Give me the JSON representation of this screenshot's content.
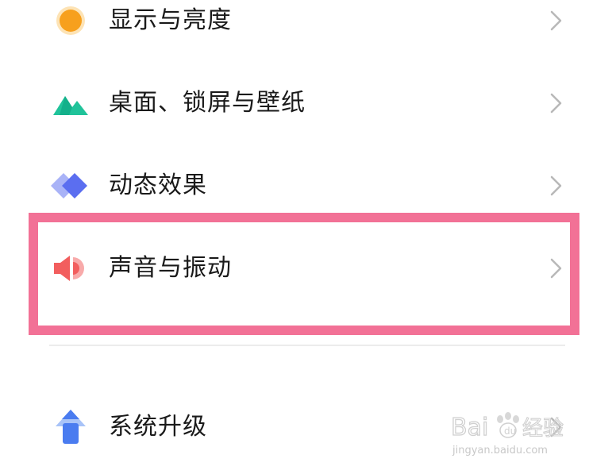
{
  "settings": {
    "items": [
      {
        "label": "显示与亮度",
        "icon": "brightness-icon",
        "color": "#f7a01d"
      },
      {
        "label": "桌面、锁屏与壁纸",
        "icon": "wallpaper-icon",
        "color": "#20c39a"
      },
      {
        "label": "动态效果",
        "icon": "animation-icon",
        "color": "#5b6ef0"
      },
      {
        "label": "声音与振动",
        "icon": "sound-icon",
        "color": "#f25e5e"
      },
      {
        "label": "系统升级",
        "icon": "upgrade-icon",
        "color": "#4a7cf0"
      }
    ]
  },
  "annotation": {
    "highlight_color": "#f27196"
  },
  "watermark": {
    "logo_text": "Baidu经验",
    "url": "jingyan.baidu.com"
  }
}
